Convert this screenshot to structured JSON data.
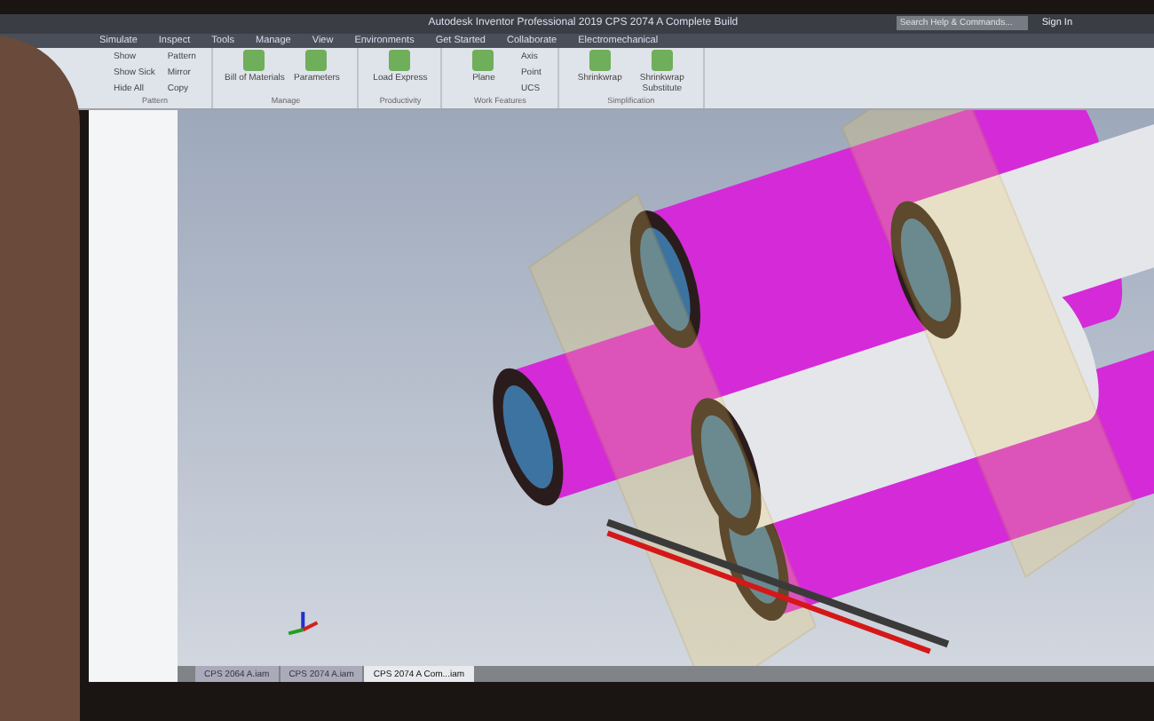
{
  "window": {
    "title": "Autodesk Inventor Professional 2019   CPS 2074 A Complete Build"
  },
  "search": {
    "placeholder": "Search Help & Commands..."
  },
  "sign_in": "Sign In",
  "tabs": [
    {
      "label": "Simulate",
      "selected": false
    },
    {
      "label": "Inspect",
      "selected": false
    },
    {
      "label": "Tools",
      "selected": false
    },
    {
      "label": "Manage",
      "selected": false
    },
    {
      "label": "View",
      "selected": false
    },
    {
      "label": "Environments",
      "selected": false
    },
    {
      "label": "Get Started",
      "selected": false
    },
    {
      "label": "Collaborate",
      "selected": false
    },
    {
      "label": "Electromechanical",
      "selected": false
    }
  ],
  "ribbon": [
    {
      "group": "Pattern",
      "tools": [
        {
          "label": "Show",
          "kind": "small"
        },
        {
          "label": "Show Sick",
          "kind": "small"
        },
        {
          "label": "Hide All",
          "kind": "small"
        },
        {
          "label": "Pattern",
          "kind": "small"
        },
        {
          "label": "Mirror",
          "kind": "small"
        },
        {
          "label": "Copy",
          "kind": "small"
        }
      ]
    },
    {
      "group": "Manage",
      "tools": [
        {
          "label": "Bill of Materials",
          "kind": "large"
        },
        {
          "label": "Parameters",
          "kind": "large"
        }
      ]
    },
    {
      "group": "Productivity",
      "tools": [
        {
          "label": "Load Express",
          "kind": "large"
        }
      ]
    },
    {
      "group": "Work Features",
      "tools": [
        {
          "label": "Plane",
          "kind": "large"
        },
        {
          "label": "Axis",
          "kind": "small"
        },
        {
          "label": "Point",
          "kind": "small"
        },
        {
          "label": "UCS",
          "kind": "small"
        }
      ]
    },
    {
      "group": "Simplification",
      "tools": [
        {
          "label": "Shrinkwrap",
          "kind": "large"
        },
        {
          "label": "Shrinkwrap Substitute",
          "kind": "large"
        }
      ]
    }
  ],
  "documents": [
    {
      "label": "CPS 2064 A.iam",
      "selected": false
    },
    {
      "label": "CPS 2074 A.iam",
      "selected": false
    },
    {
      "label": "CPS 2074 A Com...iam",
      "selected": true
    }
  ]
}
